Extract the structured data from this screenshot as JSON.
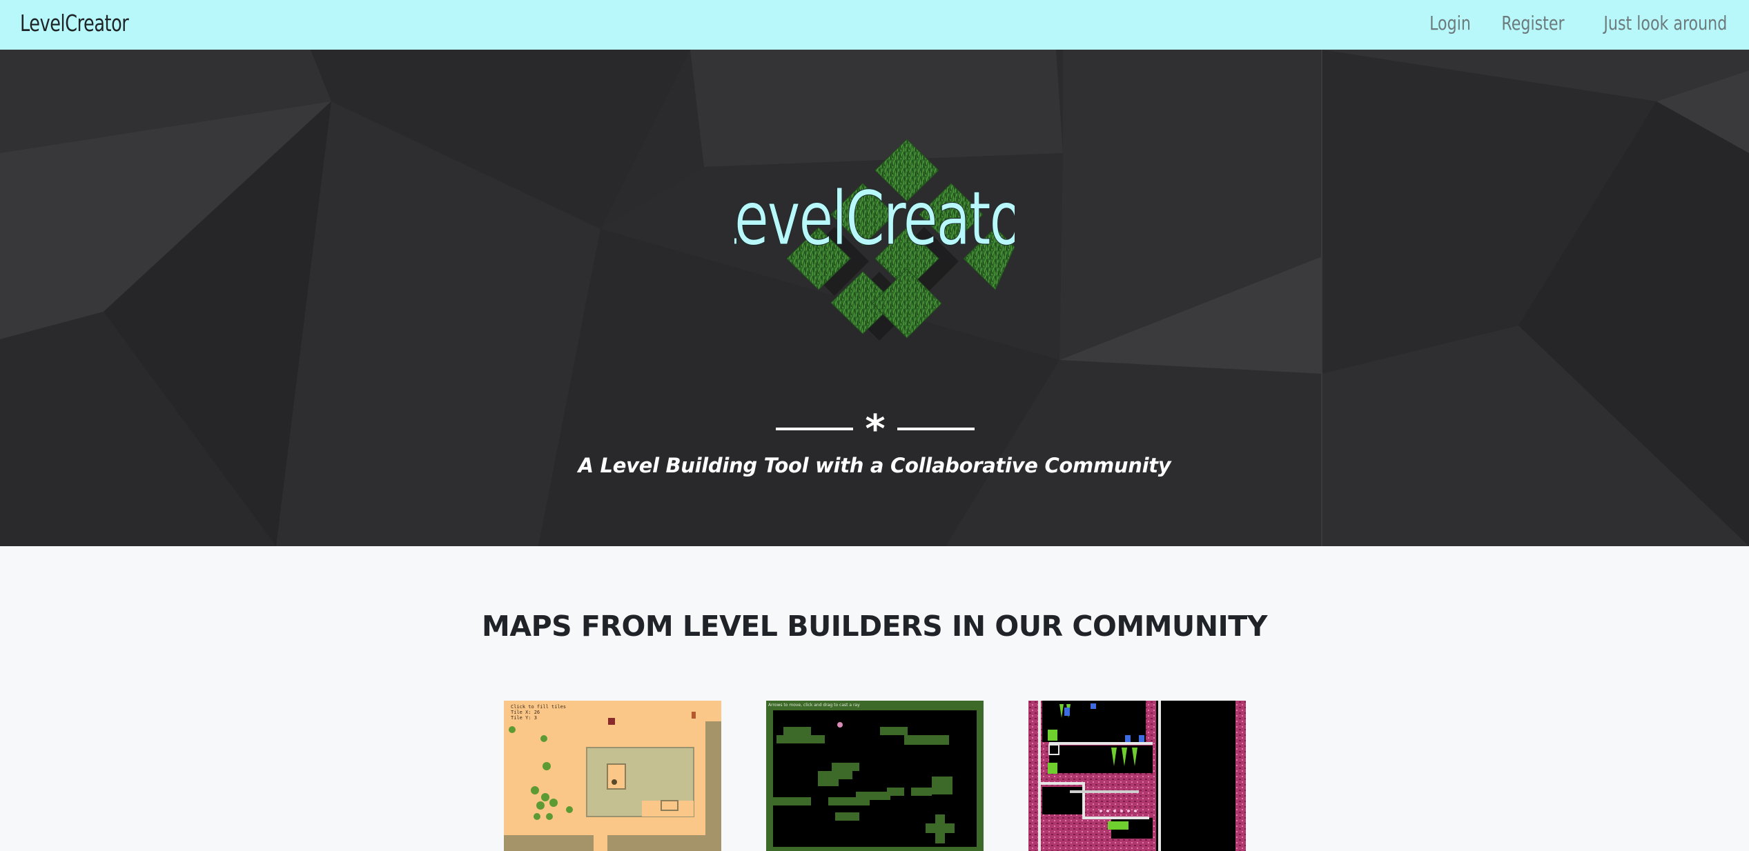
{
  "nav": {
    "brand": "LevelCreator",
    "links": [
      "Login",
      "Register",
      "Just look around"
    ]
  },
  "hero": {
    "logo_text": "LevelCreator",
    "divider_glyph": "*",
    "tagline": "A Level Building Tool with a Collaborative Community"
  },
  "community": {
    "title": "MAPS FROM LEVEL BUILDERS IN OUR COMMUNITY",
    "maps": [
      {
        "name": "desert-map",
        "lines": [
          "Click to fill tiles",
          "Tile X: 26",
          "Tile Y: 3"
        ]
      },
      {
        "name": "green-maze-map",
        "lines": [
          "Arrows to move, click and drag to cast a ray"
        ]
      },
      {
        "name": "pink-platform-map",
        "lines": []
      }
    ]
  },
  "colors": {
    "navbar_bg": "#b8f8fa",
    "hero_bg": "#2b2b2d",
    "page_bg": "#f7f8fa",
    "logo_text": "#b8f8fa",
    "grass": "#2f6b28"
  }
}
